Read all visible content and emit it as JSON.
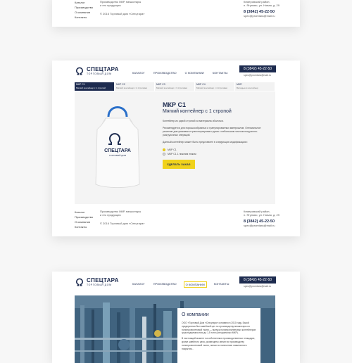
{
  "footer": {
    "links": [
      "Каталог",
      "Производство",
      "О компании",
      "Контакты"
    ],
    "about_line1": "Производство МКР, мешкотары",
    "about_line2": "и его продукция",
    "copyright": "© 2016 Торговый дом «Спецтара»",
    "address_line1": "Кемеровский район,",
    "address_line2": "п. Ягуново, ул. Новая, д. 29",
    "phone": "8 (3842) 45-22-50",
    "email": "spec@promtara@mail.ru"
  },
  "header": {
    "logo_name": "СПЕЦТАРА",
    "logo_sub": "ТОРГОВЫЙ ДОМ",
    "nav": [
      "КАТАЛОГ",
      "ПРОИЗВОДСТВО",
      "О КОМПАНИИ",
      "КОНТАКТЫ"
    ],
    "phone": "8 (3842) 45-22-50",
    "email": "spec@promtara@mail.ru"
  },
  "tabs": [
    {
      "code": "МКР С1",
      "desc": "Мягкий контейнер с 1 стропой"
    },
    {
      "code": "МКР С2",
      "desc": "Мягкий контейнер с 2 стропами"
    },
    {
      "code": "МКР С3",
      "desc": "Мягкий контейнер с 3 стропами"
    },
    {
      "code": "МКР С4",
      "desc": "Мягкий контейнер с 4 стропами"
    },
    {
      "code": "МКП",
      "desc": "Вкладыш в контейнер"
    }
  ],
  "product": {
    "title": "МКР С1",
    "subtitle": "Мягкий контейнер с 1 стропой",
    "desc1": "Контейнер из одной стропой из материала оболочки.",
    "desc2": "Рекомендуется для порошкообразных и гранулированных материалов. Оптимальное решение для упаковки и транспортировки грузов с небольшим числом погрузочно-разгрузочных операций.",
    "desc3": "Данный контейнер может быть представлен в следующих модификациях:",
    "options": [
      "МКР С1",
      "МКР С1.1 нижним люком"
    ],
    "button": "СДЕЛАТЬ ЗАКАЗ",
    "bag_brand": "СПЕЦТАРА",
    "bag_sub": "ТОРГОВЫЙ ДОМ"
  },
  "about": {
    "title": "О компании",
    "text1": "ООО «Торговый Дом «Спецтара» основано в 2010 году. Базой предприятия был швейный цех по производству мешкотары из полипропиленовой ткани — выпуск полипропиленовых контейнеров грузоподъемностью до 1,5 тонн (специальных МКР).",
    "text2": "В настоящий момент на собственных производственных площадях, кроме швейного цеха, размещены линии по производству полипропиленовой ткани, линии по нанесению ламинатного покрытия..."
  },
  "colors": {
    "brand_navy": "#1d2b4f",
    "accent_yellow": "#f0d21c",
    "tab_gray": "#f2f2f2"
  }
}
